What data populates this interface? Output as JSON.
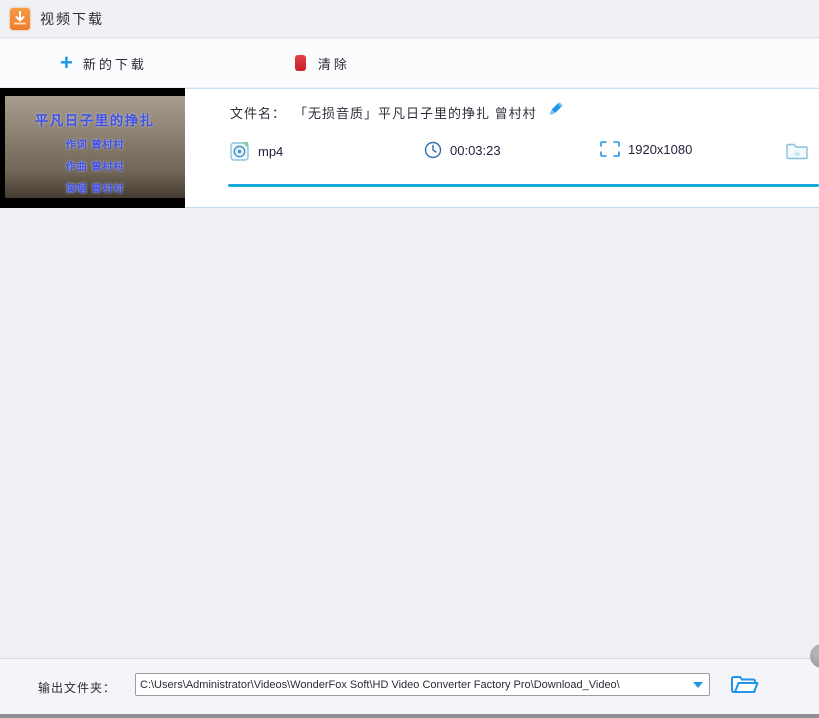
{
  "window": {
    "title": "视频下载"
  },
  "toolbar": {
    "new_download_label": "新的下载",
    "clear_label": "清除"
  },
  "download_item": {
    "filename_label": "文件名：",
    "filename": "「无损音质」平凡日子里的挣扎  曾村村",
    "format": "mp4",
    "duration": "00:03:23",
    "resolution": "1920x1080",
    "thumbnail": {
      "title": "平凡日子里的挣扎",
      "credits": [
        "作词 曾村村",
        "作曲 曾村村",
        "演唱 曾村村"
      ]
    }
  },
  "output_bar": {
    "label": "输出文件夹：",
    "path": "C:\\Users\\Administrator\\Videos\\WonderFox Soft\\HD Video Converter Factory Pro\\Download_Video\\"
  },
  "colors": {
    "accent_blue": "#1e97e8",
    "progress_cyan": "#18a9dd",
    "app_icon_orange": "#ed7d2b",
    "clear_red": "#d8242e"
  }
}
